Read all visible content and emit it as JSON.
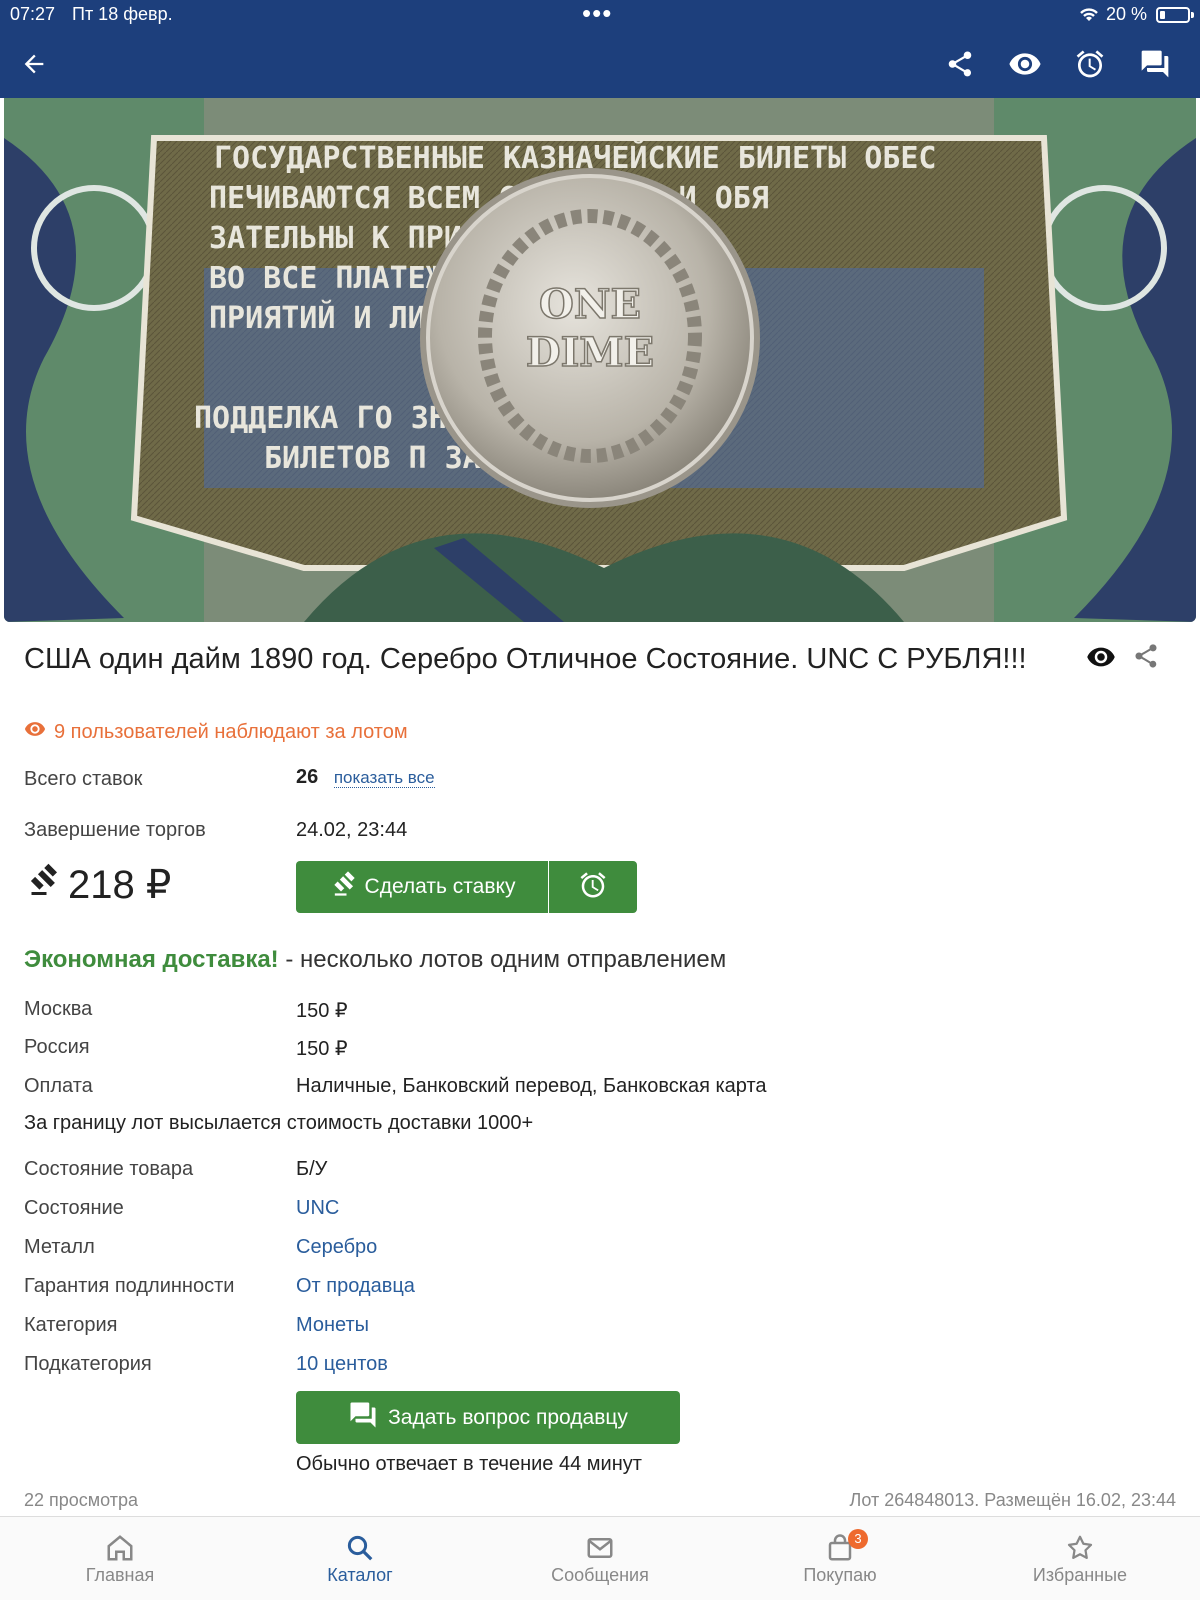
{
  "status_bar": {
    "time": "07:27",
    "date": "Пт 18 февр.",
    "dots": "•••",
    "battery": "20 %"
  },
  "toolbar": {
    "icons": [
      "back-arrow-icon",
      "share-icon",
      "eye-icon",
      "alarm-icon",
      "chat-icon"
    ]
  },
  "photo": {
    "note_text_line1": "ГОСУДАРСТВЕННЫЕ КАЗНАЧЕЙСКИЕ БИЛЕТЫ ОБЕС",
    "coin_line1": "ONE",
    "coin_line2": "DIME"
  },
  "lot": {
    "title": "США один дайм 1890 год. Серебро Отличное Состояние. UNC С РУБЛЯ!!!",
    "watchers": "9 пользователей наблюдают за лотом",
    "total_bids_label": "Всего ставок",
    "total_bids_value": "26",
    "show_all": "показать все",
    "end_label": "Завершение торгов",
    "end_value": "24.02, 23:44",
    "price": "218 ₽",
    "bid_button": "Сделать ставку"
  },
  "delivery": {
    "highlight": "Экономная доставка!",
    "rest": " - несколько лотов одним отправлением",
    "rows": [
      {
        "label": "Москва",
        "value": "150 ₽"
      },
      {
        "label": "Россия",
        "value": "150 ₽"
      },
      {
        "label": "Оплата",
        "value": "Наличные, Банковский перевод, Банковская карта"
      }
    ],
    "abroad": "За границу лот высылается стоимость доставки 1000+"
  },
  "specs": [
    {
      "label": "Состояние товара",
      "value": "Б/У",
      "link": false
    },
    {
      "label": "Состояние",
      "value": "UNC",
      "link": true
    },
    {
      "label": "Металл",
      "value": "Серебро",
      "link": true
    },
    {
      "label": "Гарантия подлинности",
      "value": "От продавца",
      "link": true
    },
    {
      "label": "Категория",
      "value": "Монеты",
      "link": true
    },
    {
      "label": "Подкатегория",
      "value": "10 центов",
      "link": true
    }
  ],
  "seller": {
    "ask_button": "Задать вопрос продавцу",
    "reply_time": "Обычно отвечает в течение 44 минут"
  },
  "footer": {
    "views": "22 просмотра",
    "lot_info": "Лот 264848013. Размещён 16.02, 23:44"
  },
  "tabs": [
    {
      "label": "Главная",
      "icon": "home-icon"
    },
    {
      "label": "Каталог",
      "icon": "search-icon",
      "active": true
    },
    {
      "label": "Сообщения",
      "icon": "mail-icon"
    },
    {
      "label": "Покупаю",
      "icon": "bag-icon",
      "badge": "3"
    },
    {
      "label": "Избранные",
      "icon": "star-icon"
    }
  ],
  "colors": {
    "header": "#1d3f7c",
    "green": "#3f8c3d",
    "link": "#2a5d9c",
    "watchers": "#e8703a"
  }
}
